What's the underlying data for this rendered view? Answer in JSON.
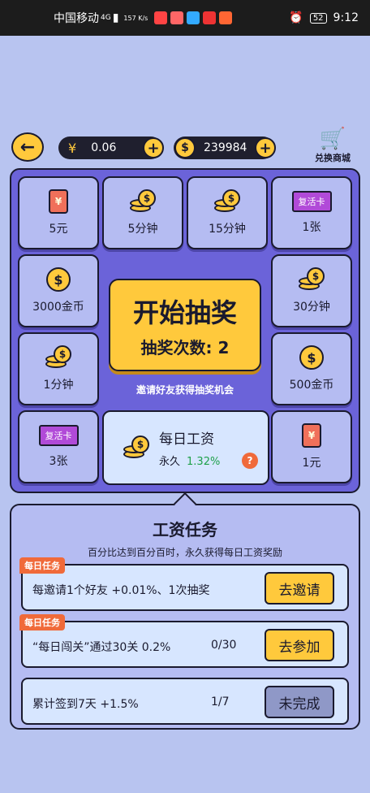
{
  "status": {
    "carrier": "中国移动",
    "net": "4G",
    "speed": "157\nK/s",
    "battery": "52",
    "time": "9:12"
  },
  "top": {
    "money": "0.06",
    "money_symbol": "¥",
    "coins": "239984",
    "coin_symbol": "$",
    "shop_label": "兑换商城"
  },
  "prizes": [
    {
      "label": "5元",
      "icon": "red-envelope"
    },
    {
      "label": "5分钟",
      "icon": "coin-stack"
    },
    {
      "label": "15分钟",
      "icon": "coin-stack"
    },
    {
      "label": "1张",
      "icon": "revive-card",
      "badge": "复活卡"
    },
    {
      "label": "3000金币",
      "icon": "coin"
    },
    {
      "label": "30分钟",
      "icon": "coin-stack"
    },
    {
      "label": "1分钟",
      "icon": "coin-stack"
    },
    {
      "label": "500金币",
      "icon": "coin"
    },
    {
      "label": "3张",
      "icon": "revive-card",
      "badge": "复活卡"
    },
    {
      "label": "1元",
      "icon": "red-envelope"
    }
  ],
  "start": {
    "title": "开始抽奖",
    "count_label": "抽奖次数: 2"
  },
  "invite_text": "邀请好友获得抽奖机会",
  "wage": {
    "title": "每日工资",
    "period": "永久",
    "percent": "1.32%"
  },
  "tasks_panel": {
    "title": "工资任务",
    "subtitle": "百分比达到百分百时，永久获得每日工资奖励",
    "tasks": [
      {
        "tag": "每日任务",
        "text": "每邀请1个好友 +0.01%、1次抽奖",
        "progress": "",
        "action": "去邀请"
      },
      {
        "tag": "每日任务",
        "text": "“每日闯关”通过30关  0.2%",
        "progress": "0/30",
        "action": "去参加"
      },
      {
        "tag": "",
        "text": "累计签到7天 +1.5%",
        "progress": "1/7",
        "action": "未完成"
      }
    ]
  },
  "colors": {
    "board": "#6b63d9",
    "cell": "#b5bcf2",
    "accent": "#ffc93c",
    "tag": "#f06a3a",
    "percent": "#1ea04a"
  }
}
